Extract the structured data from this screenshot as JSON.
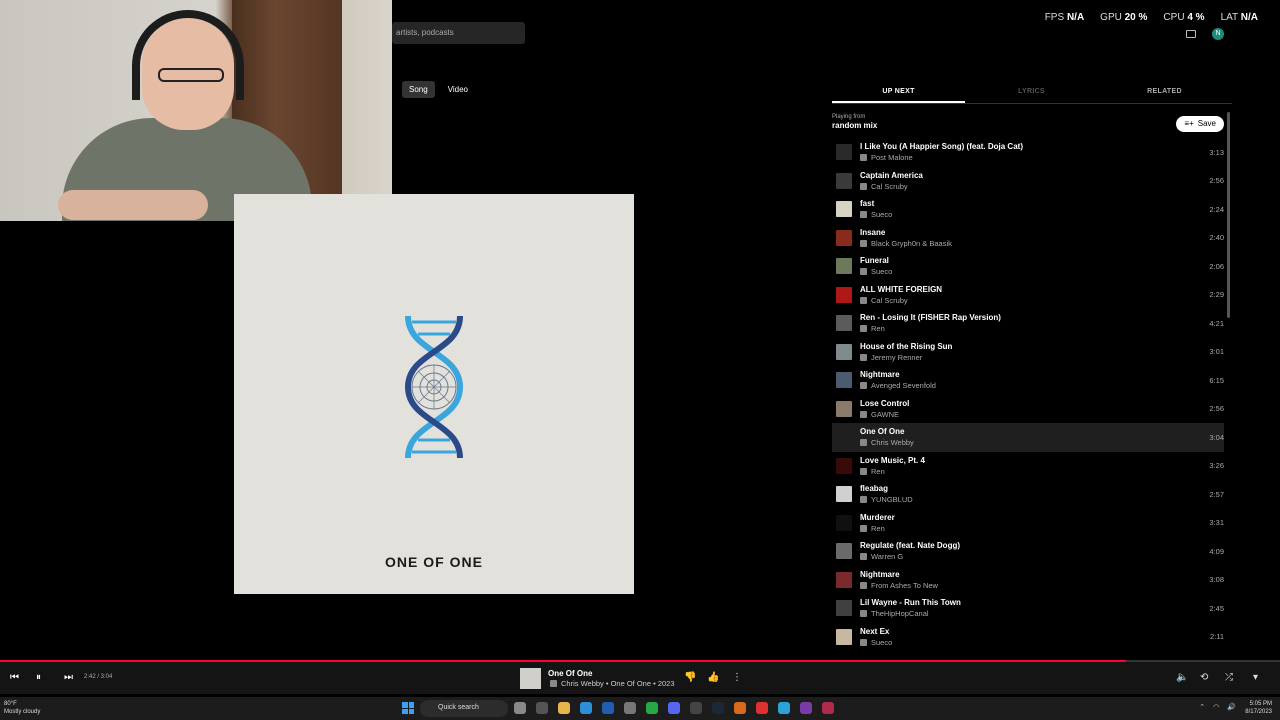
{
  "search": {
    "placeholder": "artists, podcasts"
  },
  "chips": [
    {
      "label": "Song"
    },
    {
      "label": "Video"
    }
  ],
  "perf": {
    "fps_label": "FPS",
    "fps_value": "N/A",
    "gpu_label": "GPU",
    "gpu_value": "20 %",
    "cpu_label": "CPU",
    "cpu_value": "4 %",
    "lat_label": "LAT",
    "lat_value": "N/A"
  },
  "account": {
    "initial": "N"
  },
  "album": {
    "title": "ONE OF ONE"
  },
  "panel": {
    "tabs": [
      {
        "label": "UP NEXT"
      },
      {
        "label": "LYRICS"
      },
      {
        "label": "RELATED"
      }
    ],
    "playing_from_label": "Playing from",
    "playing_from_name": "random mix",
    "save_label": "Save"
  },
  "queue": [
    {
      "title": "I Like You (A Happier Song) (feat. Doja Cat)",
      "artist": "Post Malone",
      "duration": "3:13",
      "thumb": "#2a2a2a"
    },
    {
      "title": "Captain America",
      "artist": "Cal Scruby",
      "duration": "2:56",
      "thumb": "#3a3a3a"
    },
    {
      "title": "fast",
      "artist": "Sueco",
      "duration": "2:24",
      "thumb": "#d8d2c4"
    },
    {
      "title": "Insane",
      "artist": "Black Gryph0n & Baasik",
      "duration": "2:40",
      "thumb": "#8a2a1c"
    },
    {
      "title": "Funeral",
      "artist": "Sueco",
      "duration": "2:06",
      "thumb": "#6d7a5a"
    },
    {
      "title": "ALL WHITE FOREIGN",
      "artist": "Cal Scruby",
      "duration": "2:29",
      "thumb": "#b01818"
    },
    {
      "title": "Ren - Losing It (FISHER Rap Version)",
      "artist": "Ren",
      "duration": "4:21",
      "thumb": "#5a5a5a"
    },
    {
      "title": "House of the Rising Sun",
      "artist": "Jeremy Renner",
      "duration": "3:01",
      "thumb": "#7e8a8c"
    },
    {
      "title": "Nightmare",
      "artist": "Avenged Sevenfold",
      "duration": "6:15",
      "thumb": "#4c5a72"
    },
    {
      "title": "Lose Control",
      "artist": "GAWNE",
      "duration": "2:56",
      "thumb": "#8a7a6a"
    },
    {
      "title": "One Of One",
      "artist": "Chris Webby",
      "duration": "3:04",
      "thumb": "#1f1f1f"
    },
    {
      "title": "Love Music, Pt. 4",
      "artist": "Ren",
      "duration": "3:26",
      "thumb": "#3a0a0a"
    },
    {
      "title": "fleabag",
      "artist": "YUNGBLUD",
      "duration": "2:57",
      "thumb": "#d0d0d0"
    },
    {
      "title": "Murderer",
      "artist": "Ren",
      "duration": "3:31",
      "thumb": "#101010"
    },
    {
      "title": "Regulate (feat. Nate Dogg)",
      "artist": "Warren G",
      "duration": "4:09",
      "thumb": "#6a6a6a"
    },
    {
      "title": "Nightmare",
      "artist": "From Ashes To New",
      "duration": "3:08",
      "thumb": "#7a2a2a"
    },
    {
      "title": "Lil Wayne - Run This Town",
      "artist": "TheHipHopCanal",
      "duration": "2:45",
      "thumb": "#404040"
    },
    {
      "title": "Next Ex",
      "artist": "Sueco",
      "duration": "2:11",
      "thumb": "#c8b8a0"
    }
  ],
  "player": {
    "time": "2:42 / 3:04",
    "progress": 0.88,
    "now_title": "One Of One",
    "now_sub": "Chris Webby • One Of One • 2023"
  },
  "taskbar": {
    "weather_temp": "80°F",
    "weather_desc": "Mostly cloudy",
    "search_label": "Quick search",
    "clock_time": "5:05 PM",
    "clock_date": "8/17/2023"
  },
  "colors": {
    "accent": "#ff0033",
    "teal": "#1a8f7a",
    "dna_blue": "#3aa6dd",
    "dna_navy": "#2a4a8a"
  }
}
